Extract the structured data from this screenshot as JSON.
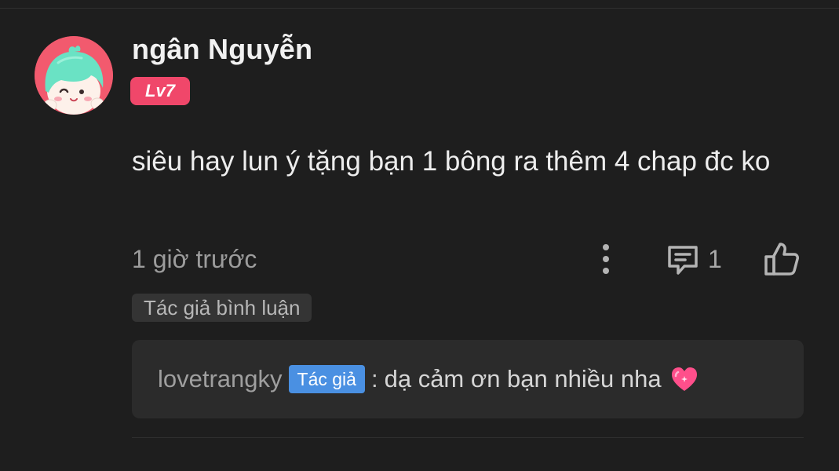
{
  "comment": {
    "username": "ngân Nguyễn",
    "level_badge": "Lv7",
    "avatar_icon": "cartoon-girl-avatar",
    "text": "siêu hay lun ý tặng bạn 1 bông ra thêm 4 chap đc ko",
    "timestamp": "1 giờ trước",
    "more_icon": "vertical-ellipsis-icon",
    "reply_icon": "comment-bubble-icon",
    "reply_count": "1",
    "like_icon": "thumbs-up-icon",
    "author_commented_tag": "Tác giả bình luận"
  },
  "reply": {
    "author": "lovetrangky",
    "author_badge": "Tác giả",
    "separator": ":",
    "text": "dạ cảm ơn bạn nhiều nha",
    "emoji_icon": "sparkling-heart-icon"
  },
  "colors": {
    "background": "#1e1e1e",
    "level_badge": "#f0476a",
    "author_badge": "#4a90e2",
    "reply_box": "#2b2b2b",
    "avatar_background": "#f25a6e",
    "heart": "#ff4f8b"
  }
}
